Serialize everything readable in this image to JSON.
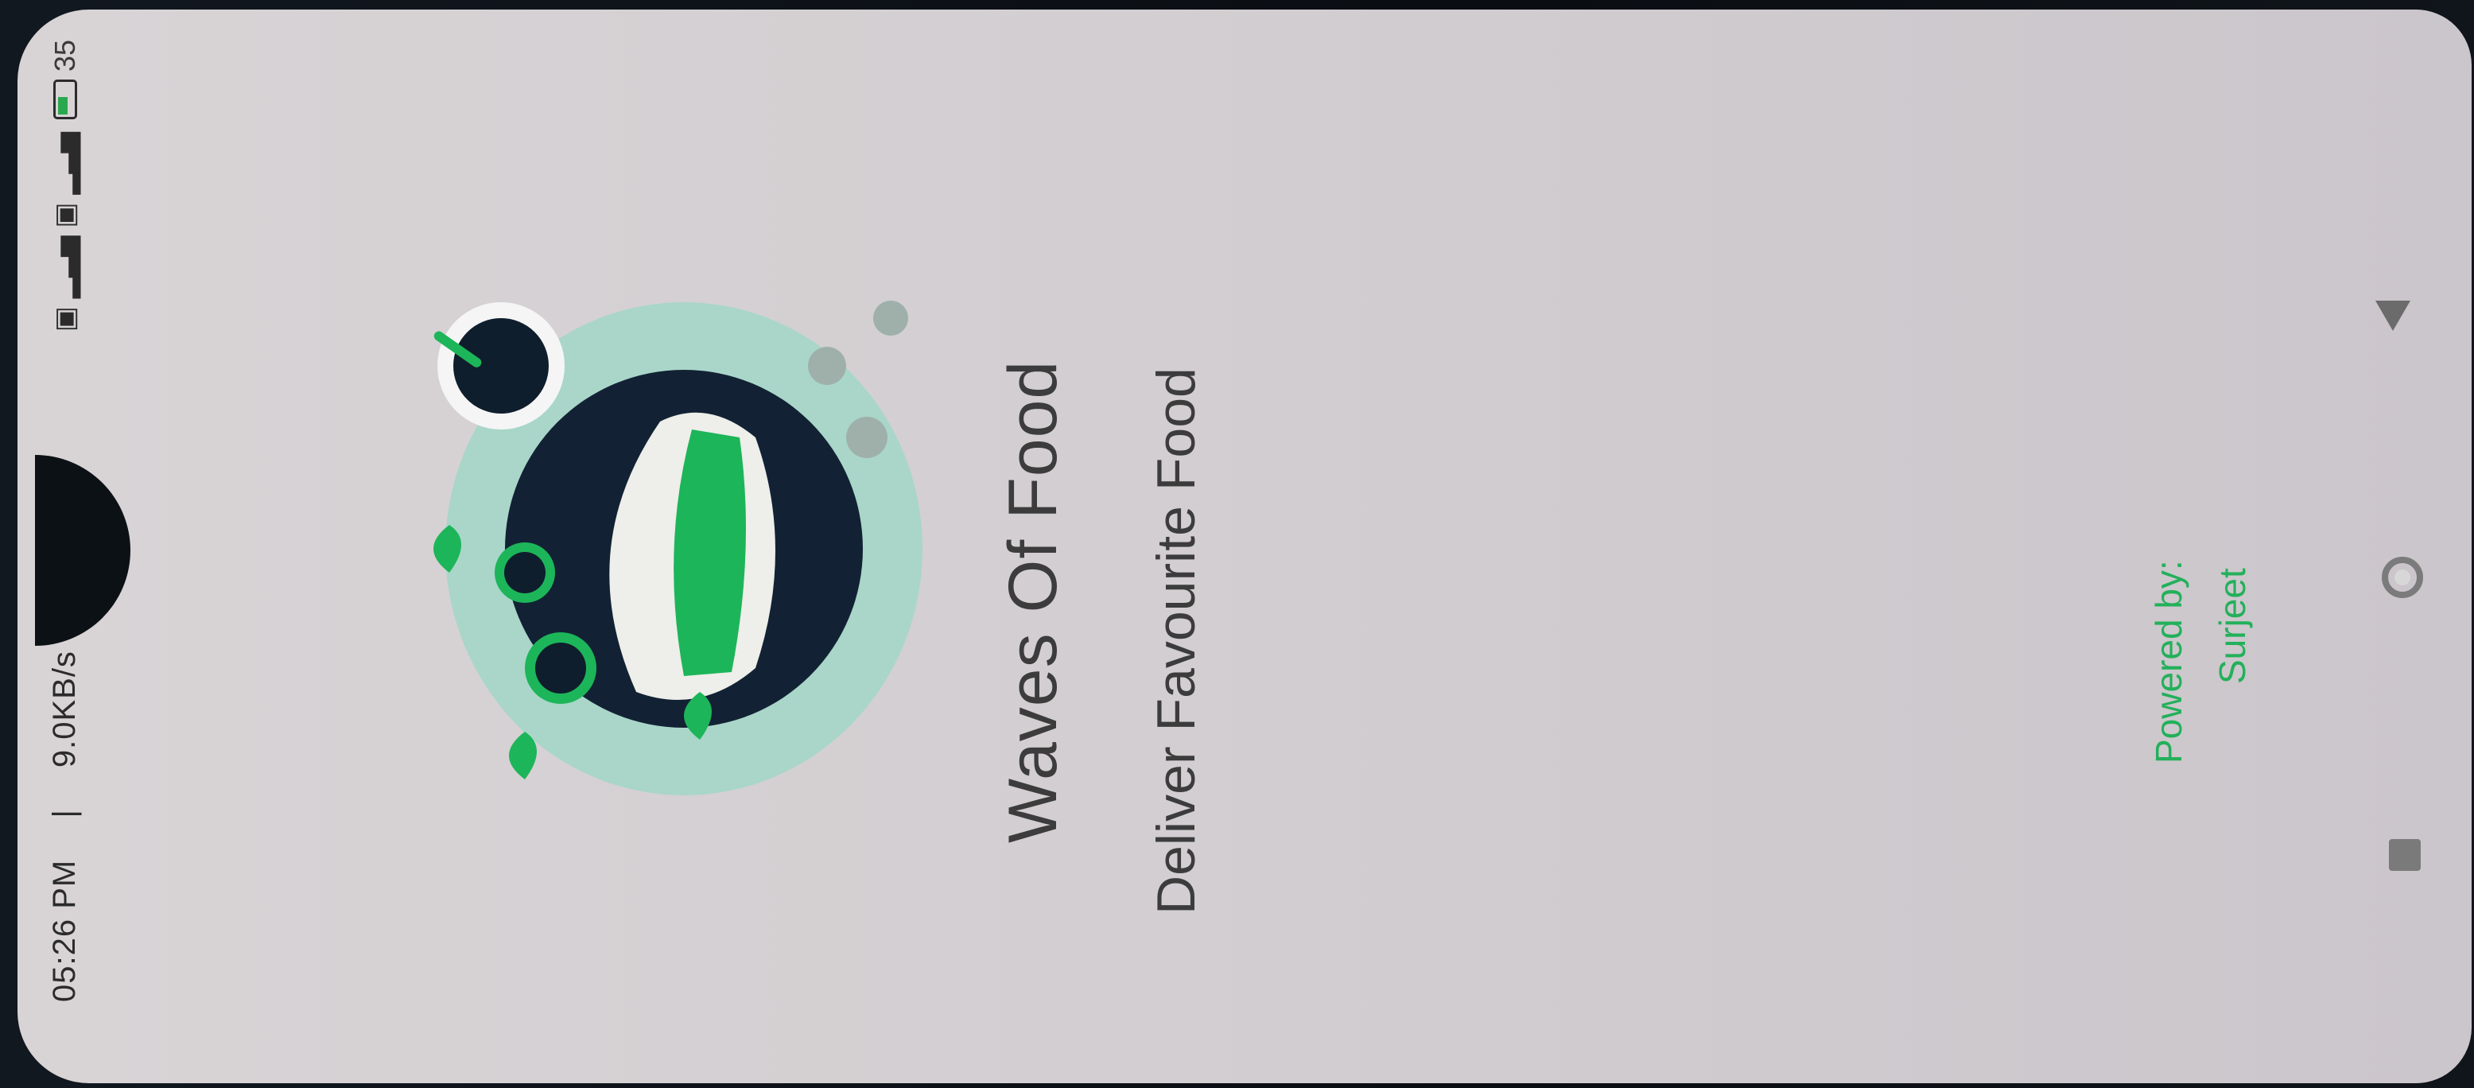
{
  "status_bar": {
    "time": "05:26 PM",
    "network_speed": "9.0KB/s",
    "battery": "35",
    "icons": [
      "sim-icon",
      "signal-icon",
      "wifi-signal-icon",
      "battery-icon"
    ]
  },
  "splash": {
    "title": "Waves Of Food",
    "subtitle": "Deliver Favourite Food",
    "powered_by_label": "Powered by:",
    "powered_by_name": "Surjeet"
  },
  "navigation": {
    "back": "back-icon",
    "home": "home-icon",
    "recents": "recents-icon"
  },
  "colors": {
    "accent": "#23b05a",
    "text": "#3c3c3c",
    "background": "#d6d2d4"
  }
}
